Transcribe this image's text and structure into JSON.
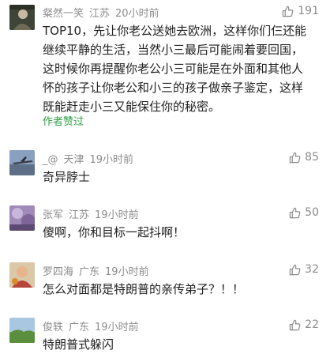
{
  "comments": [
    {
      "user": "粲然一笑",
      "location": "江苏",
      "time": "20小时前",
      "likes": "191",
      "lines": [
        "TOP10，先让你老公送她去欧洲，这样你们仨还能",
        "继续平静的生活，当然小三最后可能闹着要回国，",
        "这时候你再提醒你老公小三可能是在外面和其他人",
        "怀的孩子让你老公和小三的孩子做亲子鉴定，这样",
        "既能赶走小三又能保住你的秘密。"
      ],
      "badge": "作者赞过"
    },
    {
      "user": "_@",
      "location": "天津",
      "time": "19小时前",
      "likes": "85",
      "text": "奇异脖士"
    },
    {
      "user": "张军",
      "location": "江苏",
      "time": "19小时前",
      "likes": "50",
      "text": "傻啊，你和目标一起抖啊！"
    },
    {
      "user": "罗四海",
      "location": "广东",
      "time": "19小时前",
      "likes": "32",
      "text": "怎么对面都是特朗普的亲传弟子？！！"
    },
    {
      "user": "俊轶",
      "location": "广东",
      "time": "19小时前",
      "likes": "22",
      "text": "特朗普式躲闪"
    }
  ],
  "icons": {
    "like": "thumbs-up-icon"
  },
  "colors": {
    "author_liked": "#2fa043",
    "meta": "#8c8c8c"
  }
}
